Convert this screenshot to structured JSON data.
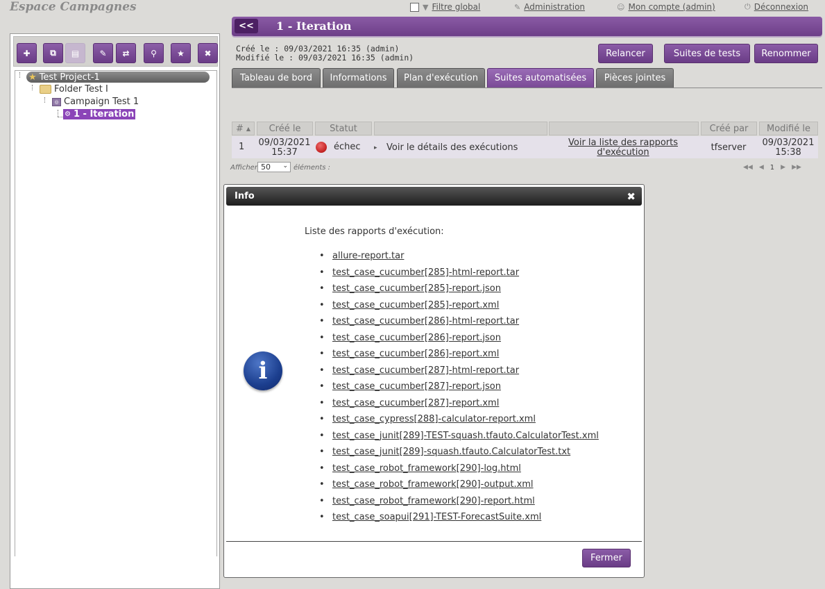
{
  "app": {
    "title": "Espace Campagnes"
  },
  "topnav": {
    "global_filter": "Filtre global",
    "administration": "Administration",
    "my_account": "Mon compte (admin)",
    "logout": "Déconnexion"
  },
  "tree": {
    "project": "Test Project-1",
    "folder": "Folder Test I",
    "campaign": "Campaign Test 1",
    "iteration": "1 - Iteration"
  },
  "header": {
    "back": "<<",
    "title": "1 - Iteration",
    "created_label": "Créé le :",
    "created_value": "09/03/2021 16:35 (admin)",
    "modified_label": "Modifié le :",
    "modified_value": "09/03/2021 16:35 (admin)"
  },
  "actions": {
    "relaunch": "Relancer",
    "test_suites": "Suites de tests",
    "rename": "Renommer"
  },
  "tabs": [
    "Tableau de bord",
    "Informations",
    "Plan d'exécution",
    "Suites automatisées",
    "Pièces jointes"
  ],
  "table": {
    "columns": [
      "#",
      "Créé le",
      "Statut",
      "",
      "",
      "Créé par",
      "Modifié le"
    ],
    "row": {
      "num": "1",
      "created_date": "09/03/2021",
      "created_time": "15:37",
      "status": "échec",
      "details": "Voir le détails des exécutions",
      "reports_line1": "Voir la liste des rapports",
      "reports_line2": "d'exécution",
      "created_by": "tfserver",
      "modified_date": "09/03/2021",
      "modified_time": "15:38"
    },
    "show_label": "Afficher",
    "page_size": "50",
    "elements_label": "éléments :",
    "pager": {
      "first": "◀◀",
      "prev": "◀",
      "page": "1",
      "next": "▶",
      "last": "▶▶"
    }
  },
  "modal": {
    "title": "Info",
    "close_glyph": "✖",
    "info_glyph": "i",
    "list_title": "Liste des rapports d'exécution:",
    "reports": [
      "allure-report.tar",
      "test_case_cucumber[285]-html-report.tar",
      "test_case_cucumber[285]-report.json",
      "test_case_cucumber[285]-report.xml",
      "test_case_cucumber[286]-html-report.tar",
      "test_case_cucumber[286]-report.json",
      "test_case_cucumber[286]-report.xml",
      "test_case_cucumber[287]-html-report.tar",
      "test_case_cucumber[287]-report.json",
      "test_case_cucumber[287]-report.xml",
      "test_case_cypress[288]-calculator-report.xml",
      "test_case_junit[289]-TEST-squash.tfauto.CalculatorTest.xml",
      "test_case_junit[289]-squash.tfauto.CalculatorTest.txt",
      "test_case_robot_framework[290]-log.html",
      "test_case_robot_framework[290]-output.xml",
      "test_case_robot_framework[290]-report.html",
      "test_case_soapui[291]-TEST-ForecastSuite.xml"
    ],
    "close_button": "Fermer"
  },
  "colors": {
    "accent": "#7a4a96",
    "accent_dark": "#4c2063",
    "status_fail": "#cc2b2b"
  }
}
